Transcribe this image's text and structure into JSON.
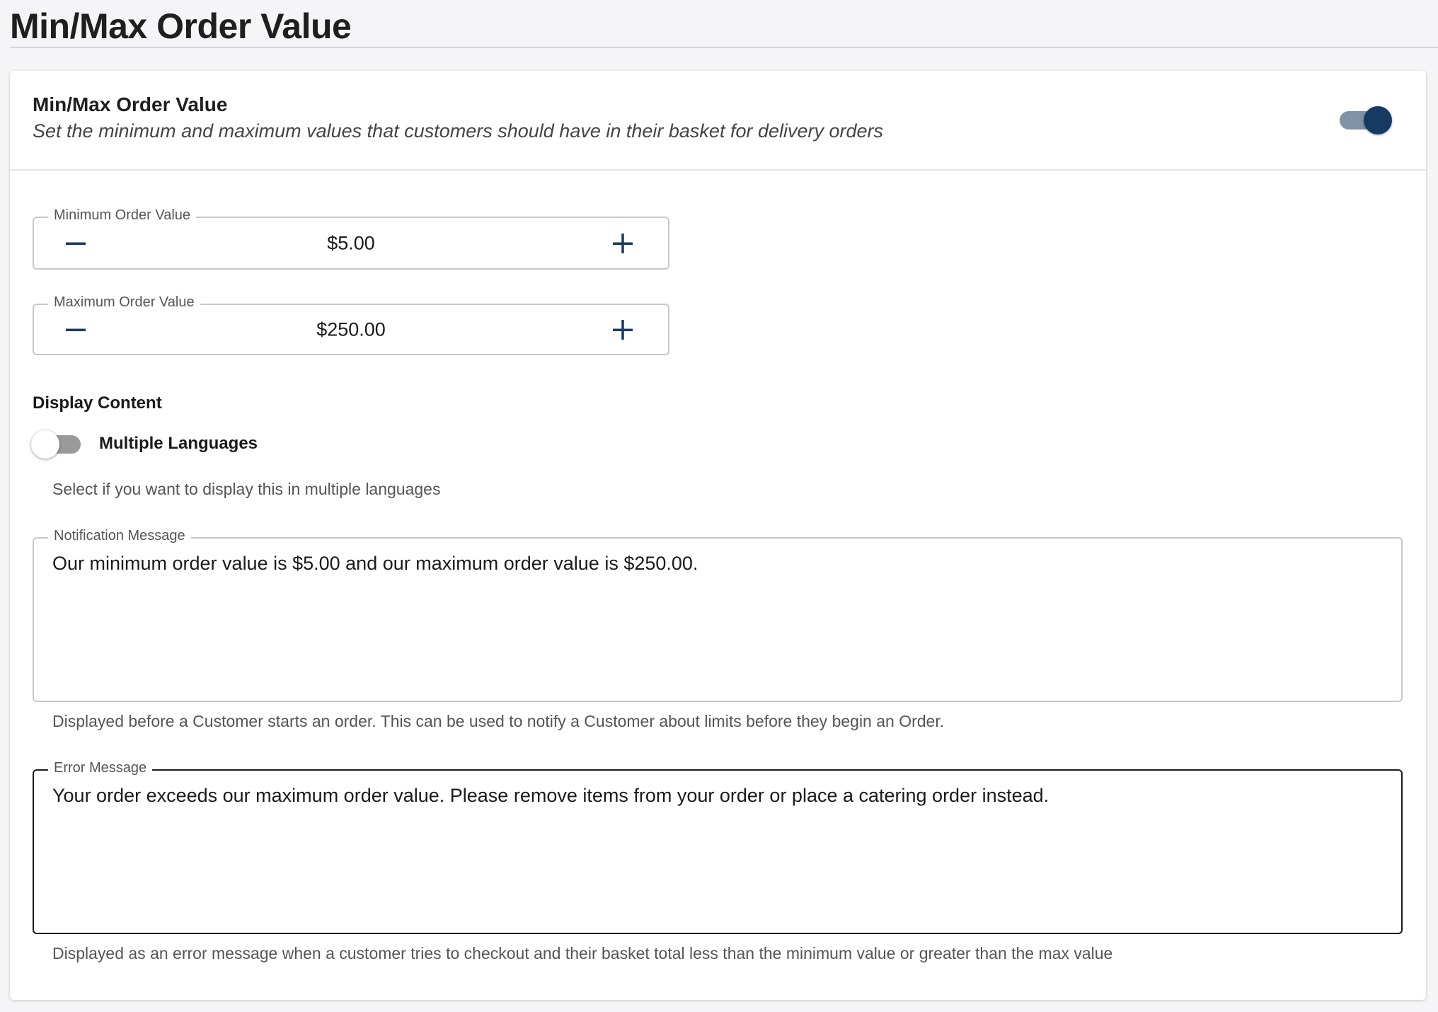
{
  "page": {
    "title": "Min/Max Order Value"
  },
  "card": {
    "title": "Min/Max Order Value",
    "subtitle": "Set the minimum and maximum values that customers should have in their basket for delivery orders",
    "enabled": true
  },
  "min_order": {
    "label": "Minimum Order Value",
    "value": "$5.00"
  },
  "max_order": {
    "label": "Maximum Order Value",
    "value": "$250.00"
  },
  "display_content": {
    "heading": "Display Content",
    "multiple_languages": {
      "label": "Multiple Languages",
      "enabled": false,
      "helper": "Select if you want to display this in multiple languages"
    }
  },
  "notification": {
    "label": "Notification Message",
    "value": "Our minimum order value is $5.00 and our maximum order value is $250.00.",
    "helper": "Displayed before a Customer starts an order. This can be used to notify a Customer about limits before they begin an Order."
  },
  "error": {
    "label": "Error Message",
    "value": "Your order exceeds our maximum order value. Please remove items from your order or place a catering order instead.",
    "helper": "Displayed as an error message when a customer tries to checkout and their basket total less than the minimum value or greater than the max value"
  },
  "colors": {
    "accent": "#173a63",
    "toggle_track_on": "#7e93a8",
    "toggle_track_off": "#9a9a9a"
  },
  "icons": {
    "decrement": "minus-icon",
    "increment": "plus-icon"
  }
}
